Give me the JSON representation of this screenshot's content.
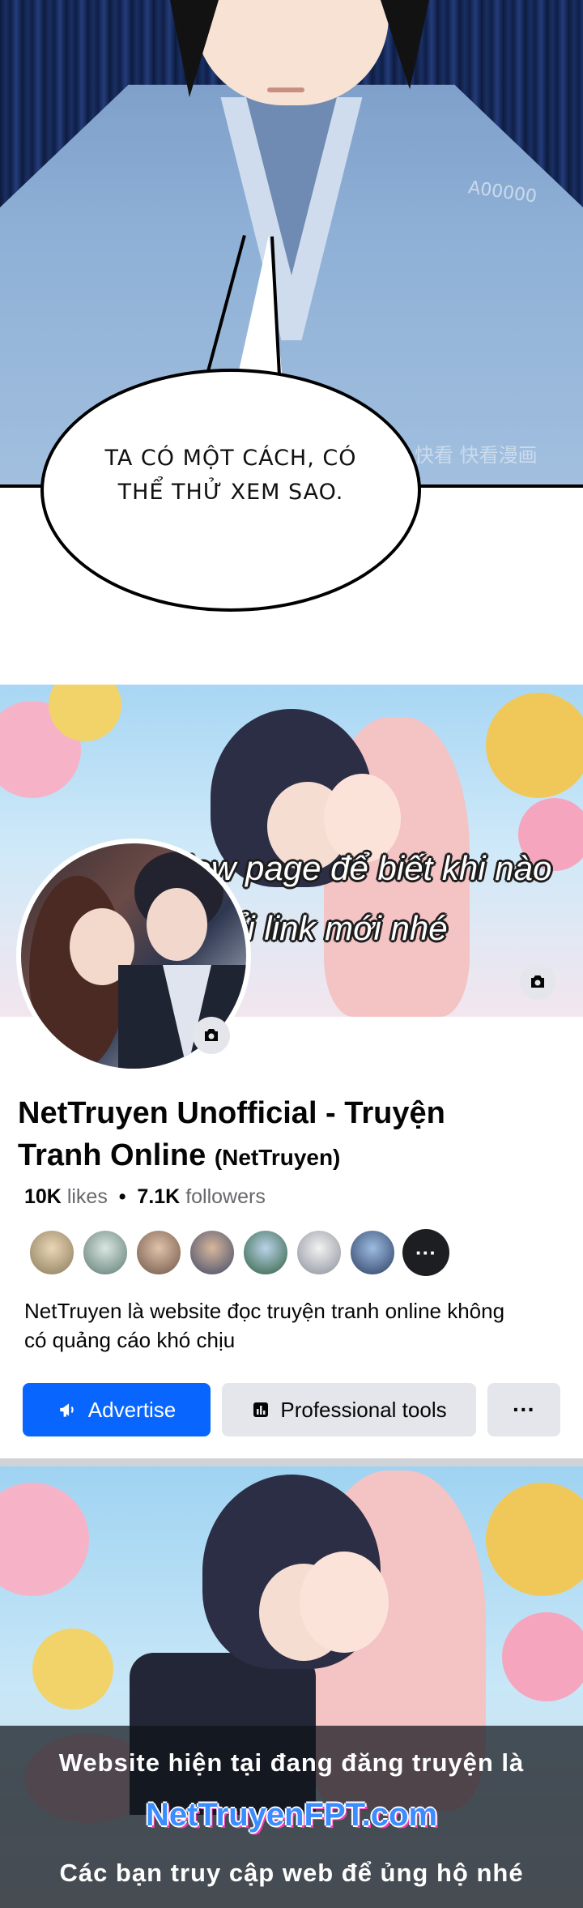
{
  "manga": {
    "dialogue": "Ta có một cách, có thể thử xem sao.",
    "watermark_code": "A00000",
    "watermark_brand": "快看 快看漫画"
  },
  "facebook_page": {
    "cover_caption": "Follow page để biết khi nào web đổi link mới nhé",
    "name": "NetTruyen Unofficial - Truyện Tranh Online",
    "handle": "(NetTruyen)",
    "likes_count": "10K",
    "likes_label": "likes",
    "separator": "•",
    "followers_count": "7.1K",
    "followers_label": "followers",
    "bio": "NetTruyen là website đọc truyện tranh online không có quảng cáo khó chịu",
    "buttons": {
      "advertise": "Advertise",
      "professional_tools": "Professional tools",
      "more": "···"
    },
    "icons": {
      "cover_camera": "camera-icon",
      "avatar_camera": "camera-icon",
      "advertise": "megaphone-icon",
      "tools": "bar-chart-icon"
    },
    "colors": {
      "primary": "#0866ff",
      "secondary_button": "#e4e6eb",
      "muted_text": "#65676b"
    }
  },
  "footer": {
    "line1": "Website hiện tại đang đăng truyện là",
    "site": "NetTruyenFPT.com",
    "line3": "Các bạn truy cập web để ủng hộ nhé"
  }
}
